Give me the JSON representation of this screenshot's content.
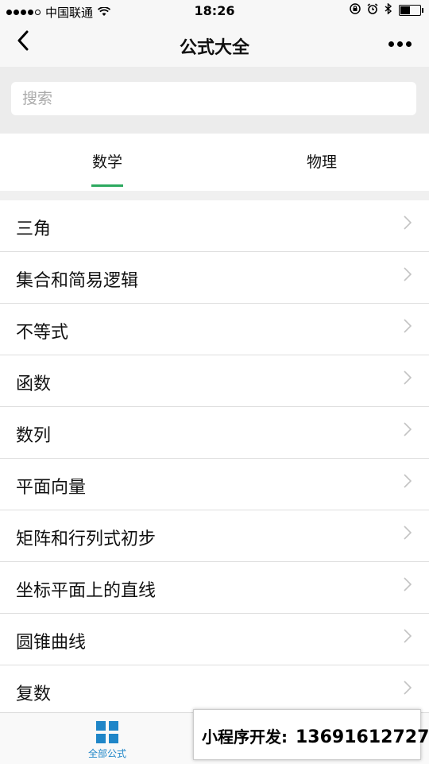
{
  "status_bar": {
    "carrier": "中国联通",
    "time": "18:26"
  },
  "navbar": {
    "back_icon": "chevron-left-icon",
    "title": "公式大全",
    "more_icon": "more-dots-icon"
  },
  "search": {
    "placeholder": "搜索",
    "value": ""
  },
  "tabs": [
    {
      "label": "数学",
      "selected": true
    },
    {
      "label": "物理",
      "selected": false
    }
  ],
  "list": [
    {
      "label": "三角"
    },
    {
      "label": "集合和简易逻辑"
    },
    {
      "label": "不等式"
    },
    {
      "label": "函数"
    },
    {
      "label": "数列"
    },
    {
      "label": "平面向量"
    },
    {
      "label": "矩阵和行列式初步"
    },
    {
      "label": "坐标平面上的直线"
    },
    {
      "label": "圆锥曲线"
    },
    {
      "label": "复数"
    }
  ],
  "tabbar": {
    "items": [
      {
        "label": "全部公式",
        "icon": "grid-icon",
        "active": true
      }
    ]
  },
  "ad": {
    "label": "小程序开发:",
    "phone": "13691612727"
  },
  "colors": {
    "accent_green": "#2ca95f",
    "tab_blue": "#1f86c8"
  }
}
